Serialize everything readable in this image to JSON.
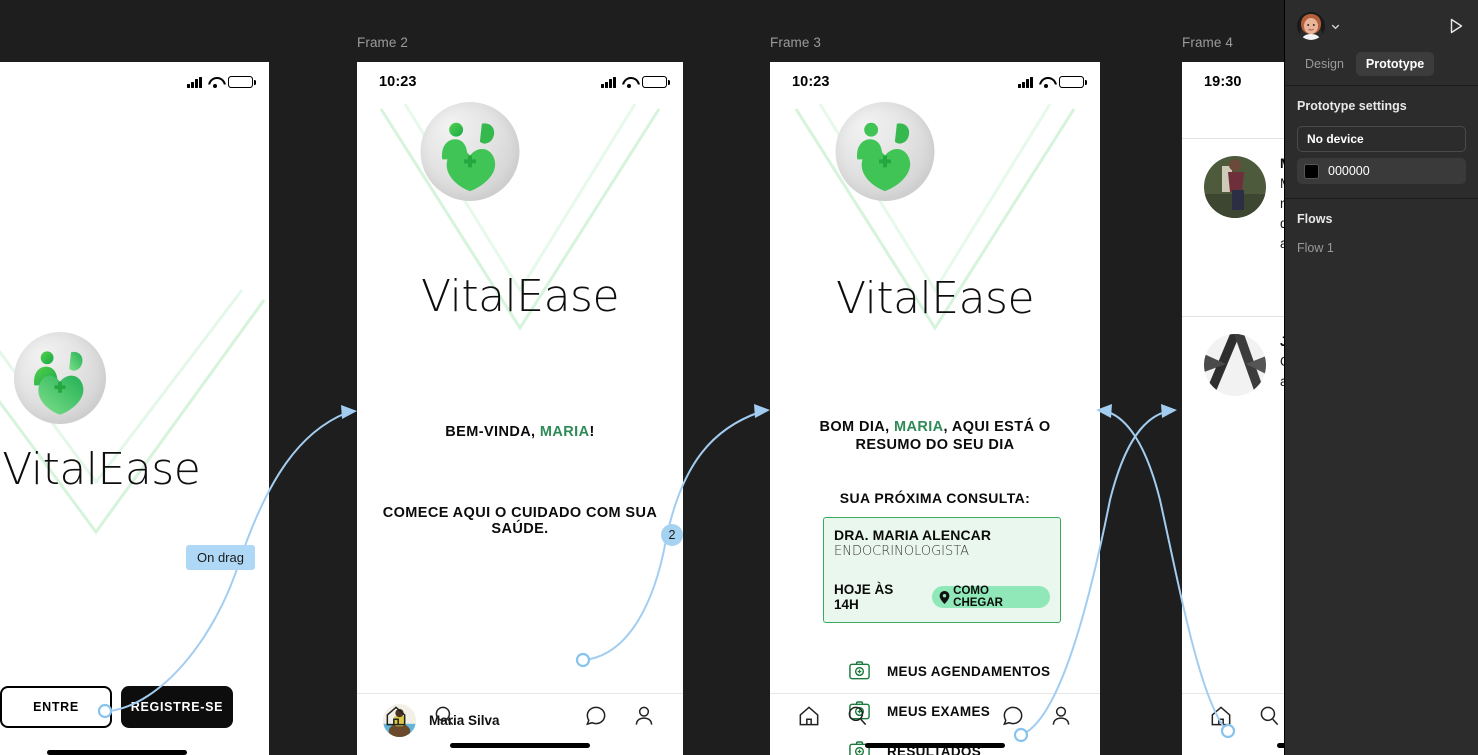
{
  "canvas": {
    "background": "#1e1e1e",
    "frame_labels": [
      "Frame 2",
      "Frame 3",
      "Frame 4"
    ],
    "connector_color": "#a3cdf0",
    "interaction_chip": "On drag",
    "connector_badge": "2"
  },
  "frame1": {
    "brand": "VitalEase",
    "buttons": {
      "login": "ENTRE",
      "register": "REGISTRE-SE"
    },
    "statusbar": {
      "time": "",
      "icons": [
        "signal-icon",
        "wifi-icon",
        "battery-icon"
      ]
    }
  },
  "frame2": {
    "label": "Frame 2",
    "statusbar": {
      "time": "10:23",
      "icons": [
        "signal-icon",
        "wifi-icon",
        "battery-icon"
      ]
    },
    "brand": "VitalEase",
    "welcome_prefix": "BEM-VINDA, ",
    "welcome_name": "MARIA",
    "welcome_suffix": "!",
    "subtitle": "COMECE AQUI O CUIDADO COM SUA SAÚDE.",
    "user": {
      "name": "Maria Silva"
    },
    "nav": [
      "home-icon",
      "search-icon",
      "chat-icon",
      "profile-icon"
    ]
  },
  "frame3": {
    "label": "Frame 3",
    "statusbar": {
      "time": "10:23",
      "icons": [
        "signal-icon",
        "wifi-icon",
        "battery-icon"
      ]
    },
    "brand": "VitalEase",
    "greet_prefix": "BOM DIA, ",
    "greet_name": "MARIA",
    "greet_suffix": ", AQUI ESTÁ O RESUMO DO SEU DIA",
    "next_appointment_label": "SUA PRÓXIMA CONSULTA:",
    "appointment": {
      "doctor": "DRA. MARIA ALENCAR",
      "specialty": "ENDOCRINOLOGISTA",
      "time": "HOJE ÀS 14H",
      "directions_button": "COMO CHEGAR",
      "card_bg": "#eaf7ef",
      "card_border": "#3aab5d",
      "button_bg": "#90e8b8"
    },
    "menu": [
      {
        "label": "MEUS AGENDAMENTOS",
        "icon": "medical-kit-icon"
      },
      {
        "label": "MEUS EXAMES",
        "icon": "medical-kit-icon"
      },
      {
        "label": "RESULTADOS",
        "icon": "medical-kit-icon"
      }
    ],
    "nav": [
      "home-icon",
      "search-icon",
      "chat-icon",
      "profile-icon"
    ]
  },
  "frame4": {
    "label": "Frame 4",
    "statusbar": {
      "time": "19:30"
    },
    "chats": [
      {
        "name": "Maria",
        "message": "Maria, combinado. Vou conferir os resultados da sua coleta. Com os dados em mãos conseguimos ajustar."
      },
      {
        "name": "Jane",
        "message": "Obrigada! Retorno em breve com as orientações."
      }
    ],
    "nav": [
      "home-icon",
      "search-icon"
    ]
  },
  "panel": {
    "tabs": [
      {
        "label": "Design",
        "active": false
      },
      {
        "label": "Prototype",
        "active": true
      }
    ],
    "prototype_settings": {
      "title": "Prototype settings",
      "device": "No device",
      "background_hex": "000000",
      "background_color": "#000000"
    },
    "flows": {
      "title": "Flows",
      "items": [
        "Flow 1"
      ]
    },
    "icons": {
      "play": "play-icon",
      "chevron": "chevron-down-icon",
      "avatar": "user-avatar"
    }
  }
}
